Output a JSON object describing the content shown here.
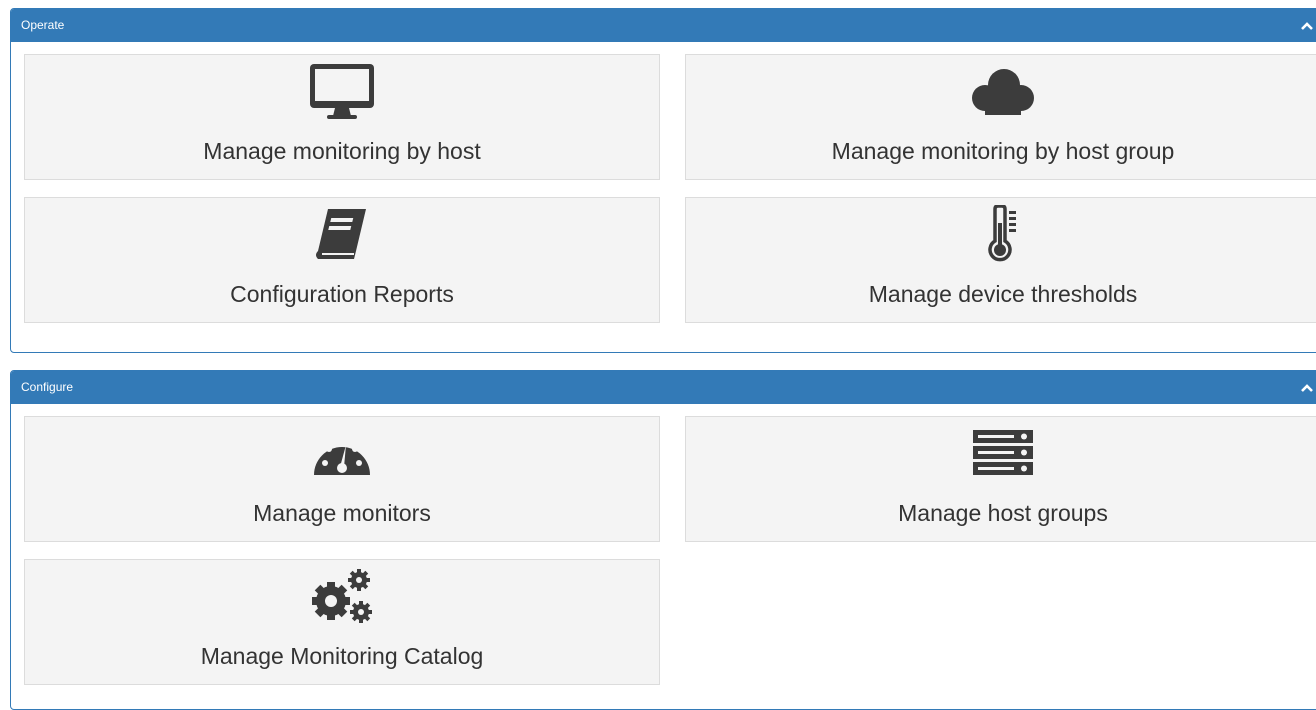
{
  "sections": [
    {
      "title": "Operate",
      "tiles": [
        {
          "label": "Manage monitoring by host",
          "icon": "desktop-icon"
        },
        {
          "label": "Manage monitoring by host group",
          "icon": "cloud-icon"
        },
        {
          "label": "Configuration Reports",
          "icon": "book-icon"
        },
        {
          "label": "Manage device thresholds",
          "icon": "thermometer-icon"
        }
      ]
    },
    {
      "title": "Configure",
      "tiles": [
        {
          "label": "Manage monitors",
          "icon": "dashboard-gauge-icon"
        },
        {
          "label": "Manage host groups",
          "icon": "server-stack-icon"
        },
        {
          "label": "Manage Monitoring Catalog",
          "icon": "cogs-icon"
        }
      ]
    }
  ],
  "colors": {
    "header": "#337ab7",
    "tile_bg": "#f4f4f4",
    "icon": "#3c3c3c"
  }
}
